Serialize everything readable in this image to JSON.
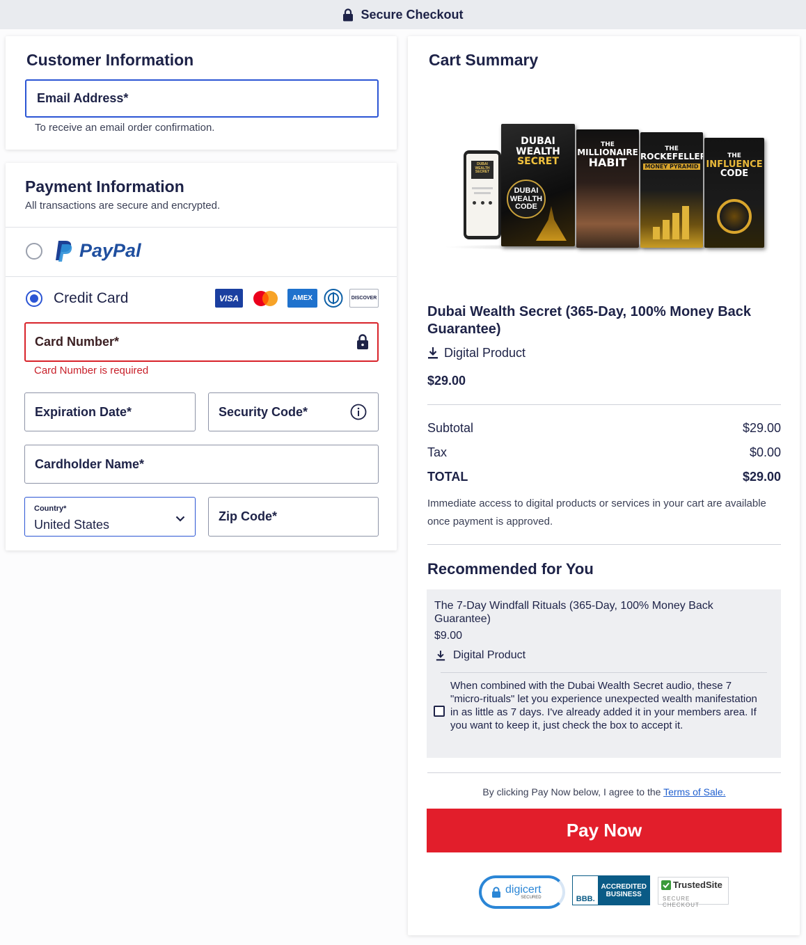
{
  "header": {
    "title": "Secure Checkout",
    "icon": "lock-icon"
  },
  "customer": {
    "title": "Customer Information",
    "email_label": "Email Address*",
    "email_help": "To receive an email order confirmation."
  },
  "payment": {
    "title": "Payment Information",
    "subtitle": "All transactions are secure and encrypted.",
    "paypal_label": "PayPal",
    "credit_card_label": "Credit Card",
    "card_brands": [
      "VISA",
      "Mastercard",
      "AMEX",
      "Diners",
      "DISCOVER"
    ],
    "card_number_label": "Card Number*",
    "card_number_error": "Card Number is required",
    "expiration_label": "Expiration Date*",
    "security_code_label": "Security Code*",
    "cardholder_label": "Cardholder Name*",
    "country_label": "Country*",
    "country_value": "United States",
    "zip_label": "Zip Code*"
  },
  "cart": {
    "title": "Cart Summary",
    "product_image": {
      "books": [
        {
          "lines": [
            "DUBAI",
            "WEALTH",
            "SECRET"
          ],
          "sub": [
            "DUBAI",
            "WEALTH",
            "CODE"
          ]
        },
        {
          "lines": [
            "THE",
            "MILLIONAIRE",
            "HABIT"
          ]
        },
        {
          "lines": [
            "THE",
            "ROCKEFELLER",
            "MONEY PYRAMID"
          ]
        },
        {
          "lines": [
            "THE",
            "INFLUENCE",
            "CODE"
          ]
        }
      ],
      "phone_lines": [
        "DUBAI",
        "WEALTH",
        "SECRET"
      ]
    },
    "product_name": "Dubai Wealth Secret (365-Day, 100% Money Back Guarantee)",
    "product_type": "Digital Product",
    "product_price": "$29.00",
    "subtotal_label": "Subtotal",
    "subtotal_value": "$29.00",
    "tax_label": "Tax",
    "tax_value": "$0.00",
    "total_label": "TOTAL",
    "total_value": "$29.00",
    "access_note": "Immediate access to digital products or services in your cart are available once payment is approved.",
    "recommended_title": "Recommended for You",
    "rec_item": {
      "name": "The 7-Day Windfall Rituals (365-Day, 100% Money Back Guarantee)",
      "price": "$9.00",
      "type": "Digital Product",
      "description": "When combined with the Dubai Wealth Secret audio, these 7 \"micro-rituals\" let you experience unexpected wealth manifestation in as little as 7 days. I've already added it in your members area. If you want to keep it, just check the box to accept it.",
      "checked": false
    },
    "terms_prefix": "By clicking Pay Now below, I agree to the ",
    "terms_link": "Terms of Sale.",
    "pay_button": "Pay Now",
    "badges": {
      "digicert": "digicert",
      "digicert_sub": "SECURED",
      "bbb": "BBB.",
      "bbb_text": "ACCREDITED BUSINESS",
      "trusted": "TrustedSite",
      "trusted_sub": "SECURE CHECKOUT"
    }
  },
  "colors": {
    "primary": "#1d2247",
    "accent_blue": "#2b55d4",
    "error_red": "#d8232a",
    "pay_red": "#e21e2b"
  }
}
